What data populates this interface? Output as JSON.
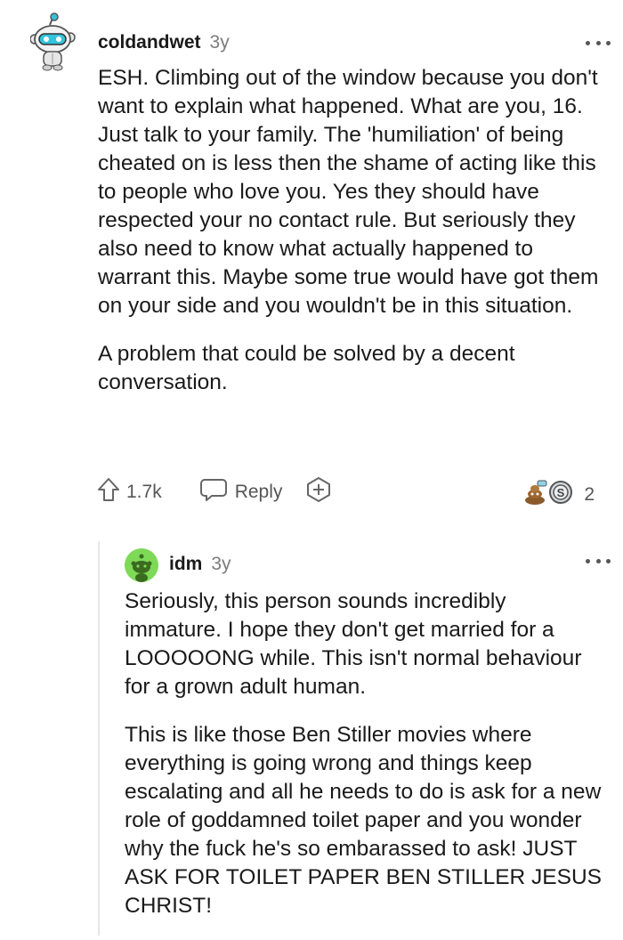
{
  "comments": [
    {
      "username": "coldandwet",
      "age": "3y",
      "paragraphs": [
        "ESH. Climbing out of the window because you don't want to explain what happened. What are you, 16. Just talk to your family. The 'humiliation' of being cheated on is less then the shame of acting like this to people who love you. Yes they should have respected your no contact rule. But seriously they also need to know what actually happened to warrant this. Maybe some true would have got them on your side and you wouldn't be in this situation.",
        "A problem that could be solved by a decent conversation."
      ],
      "upvotes": "1.7k",
      "reply_label": "Reply",
      "award_count": "2"
    },
    {
      "username": "idm",
      "age": "3y",
      "paragraphs": [
        "Seriously, this person sounds incredibly immature. I hope they don't get married for a LOOOOONG while. This isn't normal behaviour for a grown adult human.",
        "This is like those Ben Stiller movies where everything is going wrong and things keep escalating and all he needs to do is ask for a new role of goddamned toilet paper and you wonder why the fuck he's so embarassed to ask! JUST ASK FOR TOILET PAPER BEN STILLER JESUS CHRIST!"
      ]
    }
  ],
  "icons": {
    "avatar1": "snoo-avatar-icon",
    "avatar2": "snoo-avatar-icon",
    "more": "more-options-icon",
    "upvote": "upvote-arrow-icon",
    "reply": "reply-bubble-icon",
    "award": "add-award-icon",
    "awards": "awards-icon"
  },
  "colors": {
    "avatar1_accent": "#34c3dc",
    "avatar2_bg": "#7ed957",
    "text": "#1a1a1b",
    "meta": "#7c7c7c"
  }
}
